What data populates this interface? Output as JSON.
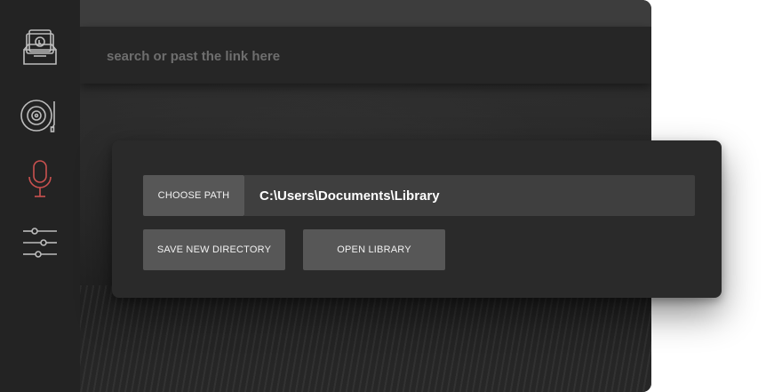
{
  "colors": {
    "sidebar_bg": "#232323",
    "icon_default": "#bdbdbd",
    "icon_active": "#c9514f",
    "button_bg": "#575757",
    "field_bg": "#3f3f3f",
    "dialog_bg": "#2a2a2a"
  },
  "sidebar": {
    "items": [
      {
        "icon": "library-box-icon",
        "active": false
      },
      {
        "icon": "turntable-icon",
        "active": false
      },
      {
        "icon": "microphone-icon",
        "active": true
      },
      {
        "icon": "sliders-icon",
        "active": false
      }
    ]
  },
  "search": {
    "placeholder": "search or past the link here",
    "value": ""
  },
  "settings_dialog": {
    "choose_path_label": "CHOOSE PATH",
    "path_value": "C:\\Users\\Documents\\Library",
    "save_directory_label": "SAVE NEW DIRECTORY",
    "open_library_label": "OPEN LIBRARY"
  }
}
